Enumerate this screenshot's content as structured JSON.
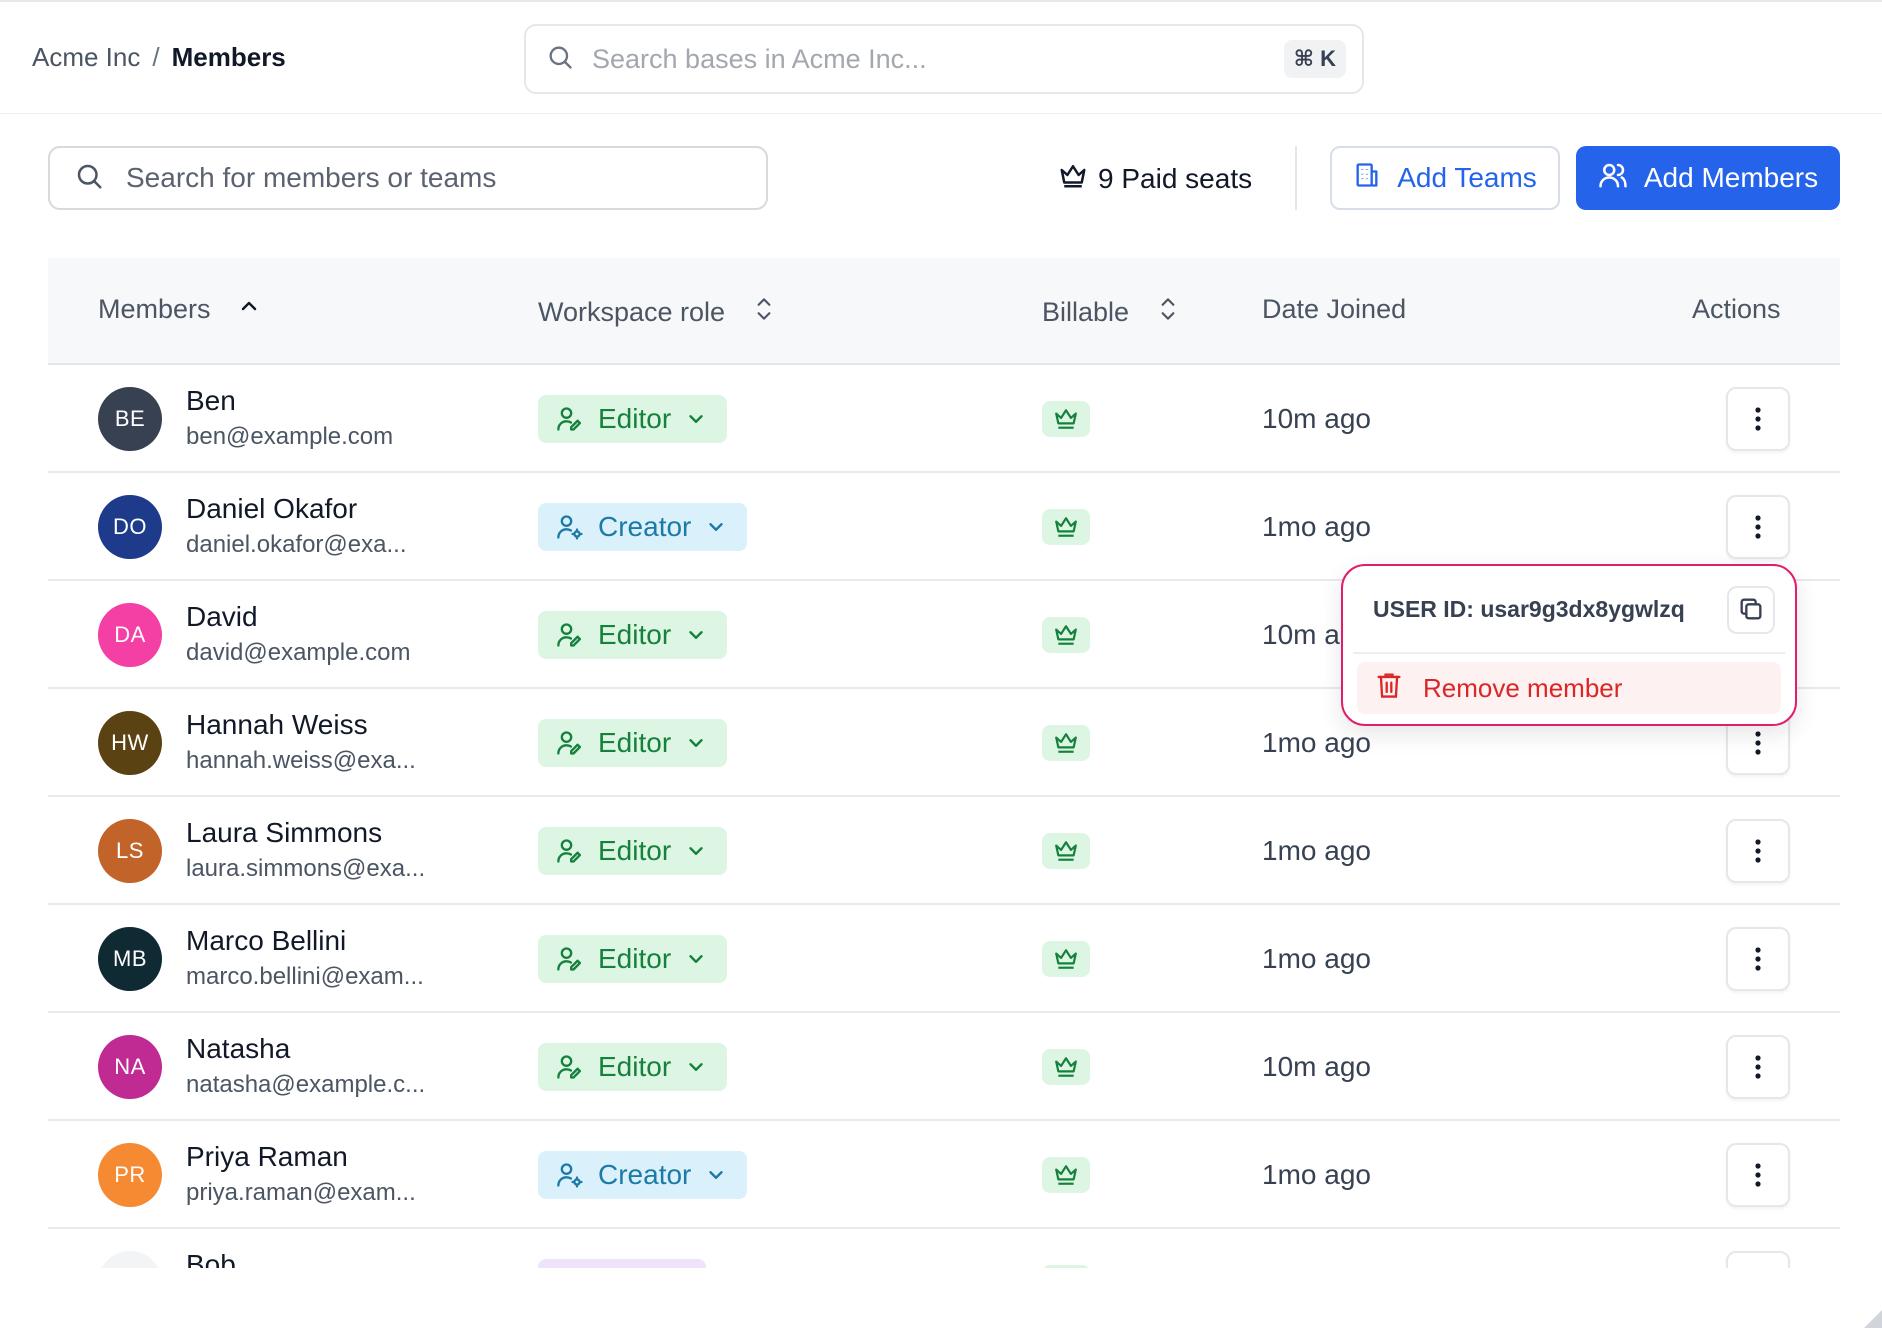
{
  "breadcrumb": {
    "org": "Acme Inc",
    "separator": "/",
    "current": "Members"
  },
  "global_search": {
    "placeholder": "Search bases in Acme Inc...",
    "shortcut": "⌘ K"
  },
  "toolbar": {
    "member_search_placeholder": "Search for members or teams",
    "paid_seats": "9 Paid seats",
    "add_teams_label": "Add Teams",
    "add_members_label": "Add Members"
  },
  "table": {
    "headers": {
      "members": "Members",
      "role": "Workspace role",
      "billable": "Billable",
      "joined": "Date Joined",
      "actions": "Actions"
    },
    "rows": [
      {
        "initials": "BE",
        "name": "Ben",
        "email": "ben@example.com",
        "role": "Editor",
        "joined": "10m ago",
        "avatar_color": "#374151"
      },
      {
        "initials": "DO",
        "name": "Daniel Okafor",
        "email": "daniel.okafor@exa...",
        "role": "Creator",
        "joined": "1mo ago",
        "avatar_color": "#1e3a8a"
      },
      {
        "initials": "DA",
        "name": "David",
        "email": "david@example.com",
        "role": "Editor",
        "joined": "10m a",
        "avatar_color": "#f43fa5"
      },
      {
        "initials": "HW",
        "name": "Hannah Weiss",
        "email": "hannah.weiss@exa...",
        "role": "Editor",
        "joined": "1mo ago",
        "avatar_color": "#5b4213"
      },
      {
        "initials": "LS",
        "name": "Laura Simmons",
        "email": "laura.simmons@exa...",
        "role": "Editor",
        "joined": "1mo ago",
        "avatar_color": "#c2642a"
      },
      {
        "initials": "MB",
        "name": "Marco Bellini",
        "email": "marco.bellini@exam...",
        "role": "Editor",
        "joined": "1mo ago",
        "avatar_color": "#0f2a33"
      },
      {
        "initials": "NA",
        "name": "Natasha",
        "email": "natasha@example.c...",
        "role": "Editor",
        "joined": "10m ago",
        "avatar_color": "#c02a93"
      },
      {
        "initials": "PR",
        "name": "Priya Raman",
        "email": "priya.raman@exam...",
        "role": "Creator",
        "joined": "1mo ago",
        "avatar_color": "#f68a33"
      },
      {
        "initials": "",
        "name": "Bob",
        "email": "",
        "role": "",
        "joined": "",
        "avatar_color": "#f3f4f6"
      }
    ]
  },
  "popup": {
    "user_id": "USER ID: usar9g3dx8ygwlzq",
    "remove_label": "Remove member"
  },
  "colors": {
    "primary": "#2563eb",
    "editor_bg": "#dcf6e3",
    "editor_fg": "#16803d",
    "creator_bg": "#daf0fb",
    "creator_fg": "#1c7aa6",
    "danger": "#dc2626",
    "popup_border": "#e11d6c"
  },
  "icons": {
    "global_search": "search-icon",
    "member_search": "search-icon",
    "seats": "crown-icon",
    "teams": "building-icon",
    "members": "users-icon",
    "sort_asc": "chevron-up-icon",
    "sort": "chevrons-up-down-icon",
    "editor": "user-pen-icon",
    "creator": "user-cog-icon",
    "billable": "crown-icon",
    "actions": "more-vertical-icon",
    "copy": "copy-icon",
    "remove": "trash-icon"
  }
}
